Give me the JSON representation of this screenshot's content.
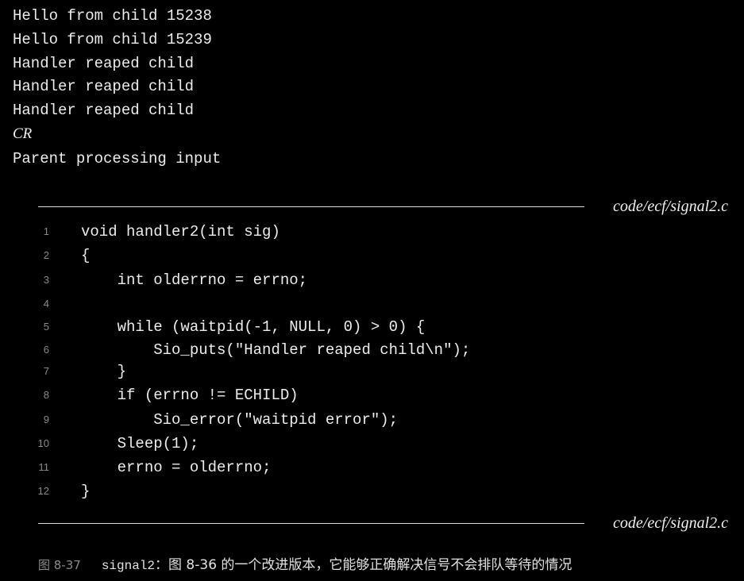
{
  "terminal_output": [
    {
      "text": "Hello from child 15238",
      "style": "mono"
    },
    {
      "text": "Hello from child 15239",
      "style": "mono"
    },
    {
      "text": "Handler reaped child",
      "style": "mono"
    },
    {
      "text": "Handler reaped child",
      "style": "mono"
    },
    {
      "text": "Handler reaped child",
      "style": "mono"
    },
    {
      "text": "CR",
      "style": "italic"
    },
    {
      "text": "Parent processing input",
      "style": "mono"
    }
  ],
  "code_listing": {
    "file_label_top": "code/ecf/signal2.c",
    "file_label_bottom": "code/ecf/signal2.c",
    "lines": [
      {
        "num": "1",
        "text": "void handler2(int sig)"
      },
      {
        "num": "2",
        "text": "{"
      },
      {
        "num": "3",
        "text": "    int olderrno = errno;"
      },
      {
        "num": "4",
        "text": ""
      },
      {
        "num": "5",
        "text": "    while (waitpid(-1, NULL, 0) > 0) {"
      },
      {
        "num": "6",
        "text": "        Sio_puts(\"Handler reaped child\\n\");"
      },
      {
        "num": "7",
        "text": "    }"
      },
      {
        "num": "8",
        "text": "    if (errno != ECHILD)"
      },
      {
        "num": "9",
        "text": "        Sio_error(\"waitpid error\");"
      },
      {
        "num": "10",
        "text": "    Sleep(1);"
      },
      {
        "num": "11",
        "text": "    errno = olderrno;"
      },
      {
        "num": "12",
        "text": "}"
      }
    ]
  },
  "caption": {
    "label": "图 8-37",
    "code": "signal2",
    "text": "：图 8-36 的一个改进版本，它能够正确解决信号不会排队等待的情况"
  }
}
